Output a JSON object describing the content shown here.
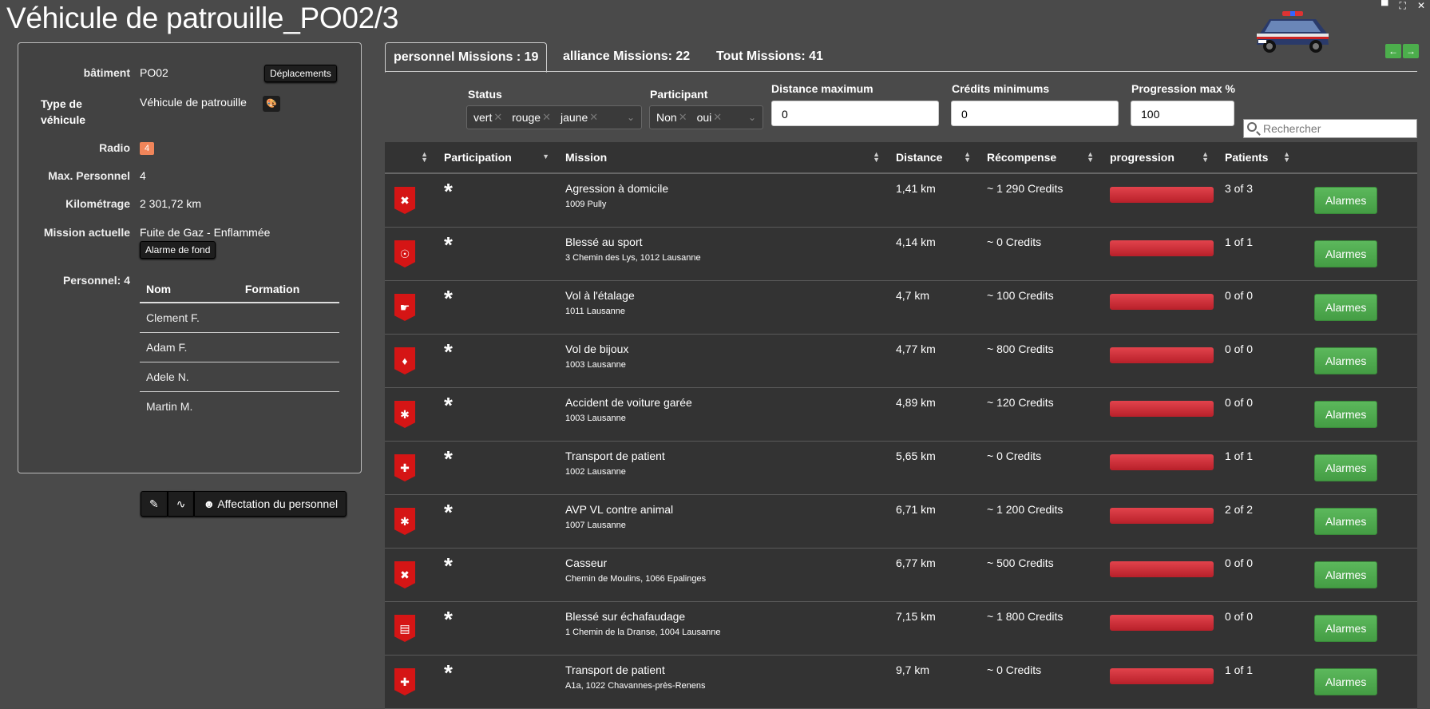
{
  "page": {
    "title": "Véhicule de patrouille_PO02/3",
    "window_controls": [
      "▀",
      "⛶",
      "✕"
    ]
  },
  "vehicle": {
    "building_label": "bâtiment",
    "building_value": "PO02",
    "move_button": "Déplacements",
    "type_label_line1": "Type de",
    "type_label_line2": "véhicule",
    "type_value": "Véhicule de patrouille",
    "radio_label": "Radio",
    "radio_value": "4",
    "max_pers_label": "Max. Personnel",
    "max_pers_value": "4",
    "km_label": "Kilométrage",
    "km_value": "2 301,72 km",
    "mission_label": "Mission actuelle",
    "mission_value": "Fuite de Gaz - Enflammée",
    "alarm_bg_button": "Alarme de fond",
    "personnel_label": "Personnel: 4",
    "personnel_headers": [
      "Nom",
      "Formation"
    ],
    "personnel": [
      "Clement F.",
      "Adam F.",
      "Adele N.",
      "Martin M."
    ]
  },
  "actions": {
    "assign_label": "Affectation du personnel"
  },
  "tabs": [
    {
      "label": "personnel Missions : 19",
      "active": true
    },
    {
      "label": "alliance Missions: 22",
      "active": false
    },
    {
      "label": "Tout Missions: 41",
      "active": false
    }
  ],
  "filters": {
    "status_label": "Status",
    "status_chips": [
      "vert",
      "rouge",
      "jaune"
    ],
    "participant_label": "Participant",
    "participant_chips": [
      "Non",
      "oui"
    ],
    "distance_label": "Distance maximum",
    "distance_value": "0",
    "credits_label": "Crédits minimums",
    "credits_value": "0",
    "progress_label": "Progression max %",
    "progress_value": "100",
    "search_placeholder": "Rechercher"
  },
  "table": {
    "headers": [
      "Participation",
      "Mission",
      "Distance",
      "Récompense",
      "progression",
      "Patients"
    ],
    "alarm_label": "Alarmes",
    "participation_mark": "*",
    "rows": [
      {
        "icon": "assault-icon",
        "name": "Agression à domicile",
        "addr": "1009 Pully",
        "dist": "1,41 km",
        "reward": "~ 1 290 Credits",
        "patients": "3 of 3"
      },
      {
        "icon": "sport-injury-icon",
        "name": "Blessé au sport",
        "addr": "3 Chemin des Lys, 1012 Lausanne",
        "dist": "4,14 km",
        "reward": "~ 0 Credits",
        "patients": "1 of 1"
      },
      {
        "icon": "shoplifting-icon",
        "name": "Vol à l'étalage",
        "addr": "1011 Lausanne",
        "dist": "4,7 km",
        "reward": "~ 100 Credits",
        "patients": "0 of 0"
      },
      {
        "icon": "jewel-theft-icon",
        "name": "Vol de bijoux",
        "addr": "1003 Lausanne",
        "dist": "4,77 km",
        "reward": "~ 800 Credits",
        "patients": "0 of 0"
      },
      {
        "icon": "car-accident-icon",
        "name": "Accident de voiture garée",
        "addr": "1003 Lausanne",
        "dist": "4,89 km",
        "reward": "~ 120 Credits",
        "patients": "0 of 0"
      },
      {
        "icon": "ambulance-icon",
        "name": "Transport de patient",
        "addr": "1002 Lausanne",
        "dist": "5,65 km",
        "reward": "~ 0 Credits",
        "patients": "1 of 1"
      },
      {
        "icon": "animal-collision-icon",
        "name": "AVP VL contre animal",
        "addr": "1007 Lausanne",
        "dist": "6,71 km",
        "reward": "~ 1 200 Credits",
        "patients": "2 of 2"
      },
      {
        "icon": "vandal-icon",
        "name": "Casseur",
        "addr": "Chemin de Moulins, 1066 Epalinges",
        "dist": "6,77 km",
        "reward": "~ 500 Credits",
        "patients": "0 of 0"
      },
      {
        "icon": "scaffold-fall-icon",
        "name": "Blessé sur échafaudage",
        "addr": "1 Chemin de la Dranse, 1004 Lausanne",
        "dist": "7,15 km",
        "reward": "~ 1 800 Credits",
        "patients": "0 of 0"
      },
      {
        "icon": "ambulance-icon",
        "name": "Transport de patient",
        "addr": "A1a, 1022 Chavannes-près-Renens",
        "dist": "9,7 km",
        "reward": "~ 0 Credits",
        "patients": "1 of 1"
      }
    ]
  }
}
